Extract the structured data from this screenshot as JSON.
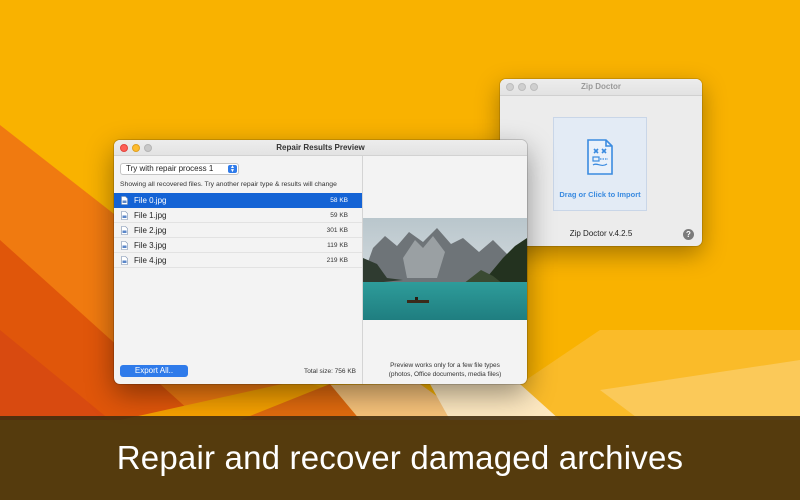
{
  "zip_doctor": {
    "title": "Zip Doctor",
    "drop_label": "Drag or Click to Import",
    "version": "Zip Doctor v.4.2.5",
    "help_label": "?"
  },
  "repair_window": {
    "title": "Repair Results Preview",
    "repair_select": "Try with repair process 1",
    "info_text": "Showing all recovered files. Try another repair type & results will change",
    "files": [
      {
        "name": "File 0.jpg",
        "size": "58 KB"
      },
      {
        "name": "File 1.jpg",
        "size": "59 KB"
      },
      {
        "name": "File 2.jpg",
        "size": "301 KB"
      },
      {
        "name": "File 3.jpg",
        "size": "119 KB"
      },
      {
        "name": "File 4.jpg",
        "size": "219 KB"
      }
    ],
    "export_label": "Export All..",
    "total_size": "Total size: 756 KB",
    "preview_note_line1": "Preview works only for a few file types",
    "preview_note_line2": "(photos, Office documents, media files)"
  },
  "banner": {
    "text": "Repair and recover damaged archives"
  },
  "colors": {
    "background": "#F9B200",
    "accent_blue": "#2F7BEA",
    "selection": "#1463D5",
    "banner": "#422D0E"
  }
}
